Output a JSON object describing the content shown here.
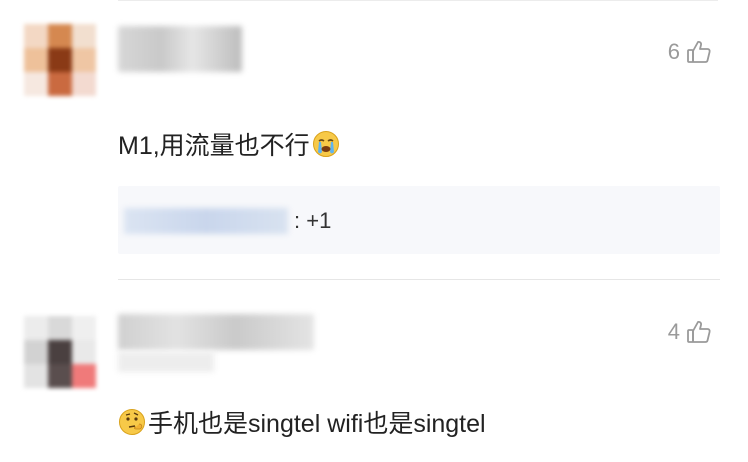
{
  "comments": [
    {
      "likes": "6",
      "text": "M1,用流量也不行",
      "trailing_emoji": "crying-face",
      "reply": {
        "text": ": +1"
      }
    },
    {
      "likes": "4",
      "leading_emoji": "thinking-face",
      "text": "手机也是singtel wifi也是singtel"
    }
  ],
  "colors": {
    "like_gray": "#9a9a9a",
    "reply_bg": "#f7f8fb"
  }
}
